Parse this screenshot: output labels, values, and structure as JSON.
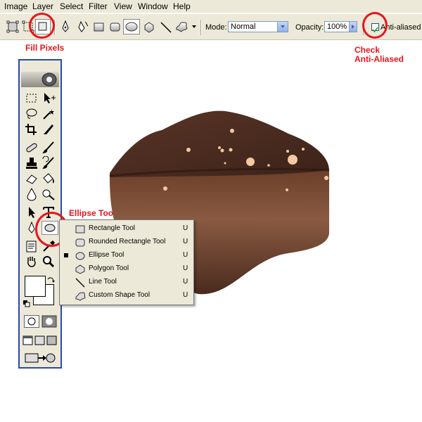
{
  "menubar": {
    "items": [
      "Image",
      "Layer",
      "Select",
      "Filter",
      "View",
      "Window",
      "Help"
    ]
  },
  "options": {
    "mode_label": "Mode:",
    "mode_value": "Normal",
    "opacity_label": "Opacity:",
    "opacity_value": "100%",
    "antialias_label": "Anti-aliased",
    "antialias_checked": true
  },
  "annotations": {
    "fill_pixels": "Fill Pixels",
    "check_line1": "Check",
    "check_line2": "Anti-Aliased",
    "ellipse_tool": "Ellipse Tool"
  },
  "flyout": {
    "items": [
      {
        "label": "Rectangle Tool",
        "key": "U",
        "icon": "rectangle-shape-icon",
        "selected": false
      },
      {
        "label": "Rounded Rectangle Tool",
        "key": "U",
        "icon": "rounded-rectangle-shape-icon",
        "selected": false
      },
      {
        "label": "Ellipse Tool",
        "key": "U",
        "icon": "ellipse-shape-icon",
        "selected": true
      },
      {
        "label": "Polygon Tool",
        "key": "U",
        "icon": "polygon-shape-icon",
        "selected": false
      },
      {
        "label": "Line Tool",
        "key": "U",
        "icon": "line-shape-icon",
        "selected": false
      },
      {
        "label": "Custom Shape Tool",
        "key": "U",
        "icon": "custom-shape-icon",
        "selected": false
      }
    ]
  },
  "colors": {
    "annotation_red": "#e8141b",
    "toolbox_border": "#2b49a6",
    "ui_bg": "#ece9d8",
    "chocolate_dark": "#3a2218",
    "chocolate_mid": "#6b4330",
    "sprinkle": "#f2c9a0"
  }
}
